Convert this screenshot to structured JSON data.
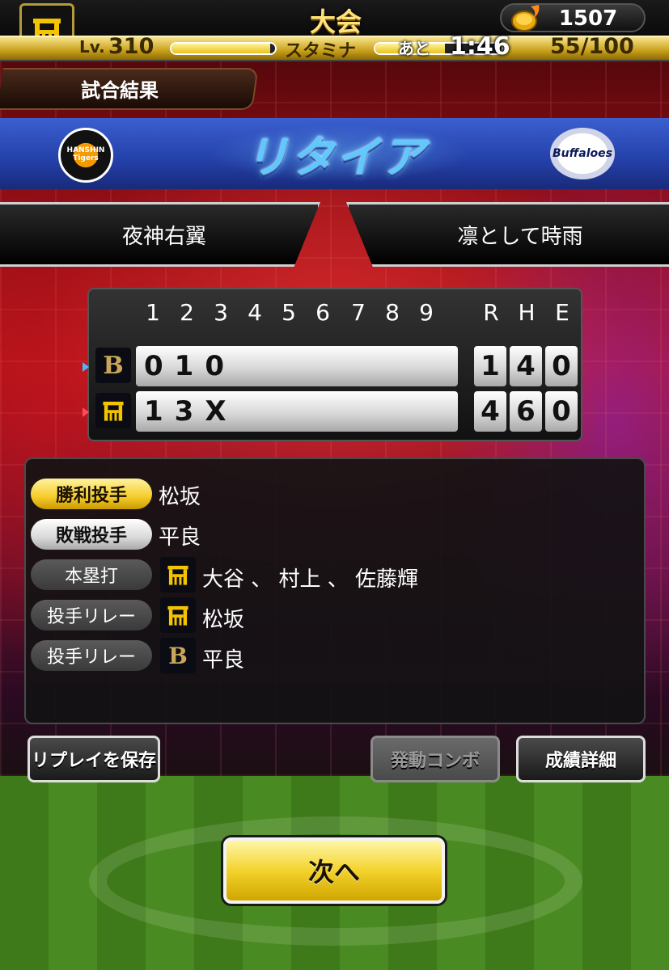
{
  "header": {
    "title": "大会",
    "coins": "1507",
    "level_prefix": "Lv.",
    "level_value": "310",
    "stamina_label": "スタミナ",
    "stamina_ato": "あと",
    "stamina_timer": "1:46",
    "stamina_count": "55/100",
    "exp_fraction": 0.95,
    "stamina_fraction": 0.55
  },
  "result": {
    "tag": "試合結果",
    "title": "リタイア",
    "home_logo_text": "HANSHIN Tigers",
    "away_logo_text": "Buffaloes"
  },
  "players": {
    "left": "夜神右翼",
    "right": "凛として時雨"
  },
  "scoreboard": {
    "innings": [
      "1",
      "2",
      "3",
      "4",
      "5",
      "6",
      "7",
      "8",
      "9"
    ],
    "rhe": [
      "R",
      "H",
      "E"
    ],
    "rows": [
      {
        "team_mark": "B",
        "innings": "010",
        "r": "1",
        "h": "4",
        "e": "0"
      },
      {
        "team_mark": "H",
        "innings": "13X",
        "r": "4",
        "h": "6",
        "e": "0"
      }
    ]
  },
  "summary": {
    "win_label": "勝利投手",
    "win_value": "松坂",
    "loss_label": "敗戦投手",
    "loss_value": "平良",
    "hr_label": "本塁打",
    "hr_value": "大谷 、 村上 、 佐藤輝",
    "relay1_label": "投手リレー",
    "relay1_value": "松坂",
    "relay2_label": "投手リレー",
    "relay2_value": "平良"
  },
  "buttons": {
    "save_replay": "リプレイを保存",
    "combo": "発動コンボ",
    "details": "成績詳細",
    "next": "次へ"
  },
  "colors": {
    "gold": "#f5cc2a",
    "tigers_yellow": "#f5c400",
    "buffaloes_gold": "#c9a65a",
    "banner_blue": "#2440a8",
    "title_blue": "#5fc8ff"
  }
}
